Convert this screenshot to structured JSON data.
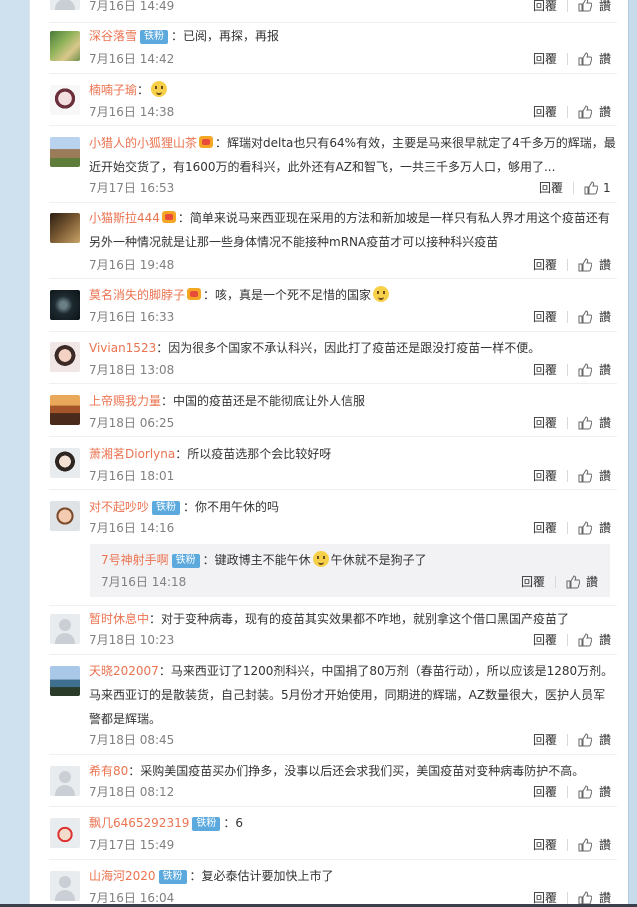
{
  "comments": [
    {
      "user": "",
      "badge": "",
      "text": "",
      "time": "7月16日 14:49",
      "reply": "回覆",
      "likes": "讚"
    },
    {
      "user": "深谷落雪",
      "badge": "铁粉",
      "text": "：已阅，再探，再报",
      "time": "7月16日 14:42",
      "reply": "回覆",
      "likes": "讚"
    },
    {
      "user": "楠喃子瑜",
      "badge": "",
      "text": "：",
      "time": "7月16日 14:38",
      "reply": "回覆",
      "likes": "讚"
    },
    {
      "user": "小猎人的小狐狸山茶",
      "badge": "",
      "text_line1": "：辉瑞对delta也只有64%有效，主要是马来很早就定了4千多万的辉瑞，最",
      "text_line2": "近开始交货了，有1600万的看科兴，此外还有AZ和智飞，一共三千多万人口，够用了...",
      "time": "7月17日 16:53",
      "reply": "回覆",
      "likes": "1"
    },
    {
      "user": "小猫斯拉444",
      "badge": "",
      "text_line1": "：简单来说马来西亚现在采用的方法和新加坡是一样只有私人界才用这个疫苗还有",
      "text_line2": "另外一种情况就是让那一些身体情况不能接种mRNA疫苗才可以接种科兴疫苗",
      "time": "7月16日 19:48",
      "reply": "回覆",
      "likes": "讚"
    },
    {
      "user": "莫名消失的脚脖子",
      "badge": "",
      "text": "：咳，真是一个死不足惜的国家",
      "time": "7月16日 16:33",
      "reply": "回覆",
      "likes": "讚"
    },
    {
      "user": "Vivian1523",
      "badge": "",
      "text": "：因为很多个国家不承认科兴，因此打了疫苗还是跟没打疫苗一样不便。",
      "time": "7月18日 13:08",
      "reply": "回覆",
      "likes": "讚"
    },
    {
      "user": "上帝赐我力量",
      "badge": "",
      "text": "：中国的疫苗还是不能彻底让外人信服",
      "time": "7月18日 06:25",
      "reply": "回覆",
      "likes": "讚"
    },
    {
      "user": "萧湘茗Diorlyna",
      "badge": "",
      "text": "：所以疫苗选那个会比较好呀",
      "time": "7月16日 18:01",
      "reply": "回覆",
      "likes": "讚"
    },
    {
      "user": "对不起吵吵",
      "badge": "铁粉",
      "text": "：你不用午休的吗",
      "time": "7月16日 14:16",
      "reply": "回覆",
      "likes": "讚"
    },
    {
      "user": "暂时休息中",
      "badge": "",
      "text": "：对于变种病毒，现有的疫苗其实效果都不咋地，就别拿这个借口黑国产疫苗了",
      "time": "7月18日 10:23",
      "reply": "回覆",
      "likes": "讚"
    },
    {
      "user": "天晓202007",
      "badge": "",
      "text_line1": "：马来西亚订了1200剂科兴，中国捐了80万剂（春苗行动），所以应该是1280万剂。",
      "text_line2": "马来西亚订的是散装货，自己封装。5月份才开始使用，同期进的辉瑞，AZ数量很大，医护人员军",
      "text_line3": "警都是辉瑞。",
      "time": "7月18日 08:45",
      "reply": "回覆",
      "likes": "讚"
    },
    {
      "user": "希有80",
      "badge": "",
      "text": "：采购美国疫苗买办们挣多，没事以后还会求我们买，美国疫苗对变种病毒防护不高。",
      "time": "7月18日 08:12",
      "reply": "回覆",
      "likes": "讚"
    },
    {
      "user": "飘几6465292319",
      "badge": "铁粉",
      "text": "：6",
      "time": "7月17日 15:49",
      "reply": "回覆",
      "likes": "讚"
    },
    {
      "user": "山海河2020",
      "badge": "铁粉",
      "text": "：复必泰估计要加快上市了",
      "time": "7月16日 16:04",
      "reply": "回覆",
      "likes": "讚"
    }
  ],
  "sub_reply": {
    "user": "7号神射手啊",
    "badge": "铁粉",
    "text_a": "：键政博主不能午休",
    "text_b": "午休就不是狗子了",
    "time": "7月16日 14:18",
    "reply": "回覆",
    "likes": "讚"
  },
  "colors": {
    "username": "#eb7350",
    "badge": "#5ca9de",
    "panel": "#ffffff",
    "backdrop": "#cfe0ee"
  }
}
